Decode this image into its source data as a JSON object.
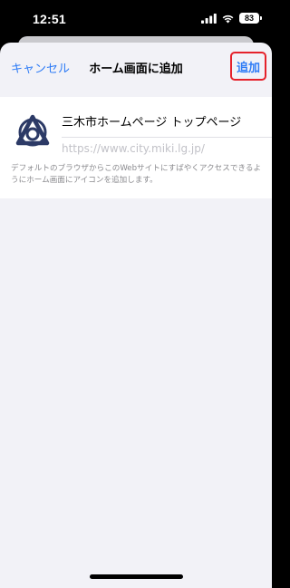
{
  "status_bar": {
    "time": "12:51",
    "battery_level": "83",
    "icons": [
      "cellular-signal-icon",
      "wifi-icon",
      "battery-icon"
    ]
  },
  "nav": {
    "cancel_label": "キャンセル",
    "title": "ホーム画面に追加",
    "add_label": "追加"
  },
  "bookmark": {
    "icon": "miki-city-logo-icon",
    "name_value": "三木市ホームページ トップページ",
    "url": "https://www.city.miki.lg.jp/"
  },
  "footnote": "デフォルトのブラウザからこのWebサイトにすばやくアクセスできるようにホーム画面にアイコンを追加します。",
  "colors": {
    "accent": "#2f7cf6",
    "highlight_border": "#e5222b",
    "sheet_background": "#f2f2f7",
    "logo_navy": "#2c3a66"
  }
}
